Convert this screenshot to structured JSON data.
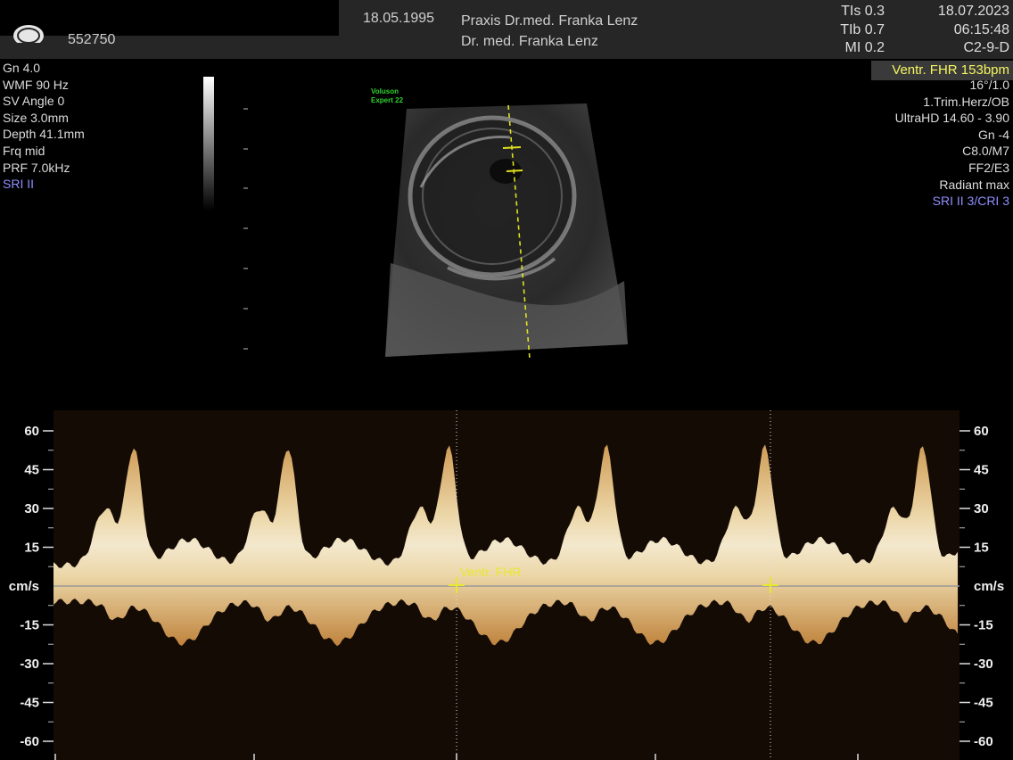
{
  "header": {
    "patient_id": "552750",
    "dob": "18.05.1995",
    "clinic_line1": "Praxis Dr.med. Franka Lenz",
    "clinic_line2": "Dr. med. Franka Lenz",
    "tis": "TIs 0.3",
    "tib": "TIb 0.7",
    "mi": "MI 0.2",
    "date": "18.07.2023",
    "time": "06:15:48",
    "probe": "C2-9-D"
  },
  "fhr_badge": "Ventr. FHR 153bpm",
  "left_params": [
    "Gn 4.0",
    "WMF 90 Hz",
    "SV Angle 0",
    "Size 3.0mm",
    "Depth 41.1mm",
    "Frq mid",
    "PRF 7.0kHz"
  ],
  "left_params_blue": "SRI II",
  "right_params": [
    "16°/1.0",
    "1.Trim.Herz/OB",
    "UltraHD 14.60 - 3.90",
    "Gn -4",
    "C8.0/M7",
    "FF2/E3",
    "Radiant max"
  ],
  "right_params_blue": "SRI II 3/CRI 3",
  "voluson": [
    "Voluson",
    "Expert 22"
  ],
  "doppler": {
    "axis_labels": [
      "60",
      "45",
      "30",
      "15",
      "cm/s",
      "-15",
      "-30",
      "-45",
      "-60"
    ],
    "marker_label": "Ventr. FHR"
  },
  "chart_data": {
    "type": "line",
    "ylabel": "cm/s",
    "ylim": [
      -60,
      60
    ],
    "yticks": [
      60,
      45,
      30,
      15,
      0,
      -15,
      -30,
      -45,
      -60
    ],
    "colors": {
      "spectrum": "#f4d9a0",
      "baseline": "#9a9a9a",
      "marker": "#e8e830"
    }
  }
}
